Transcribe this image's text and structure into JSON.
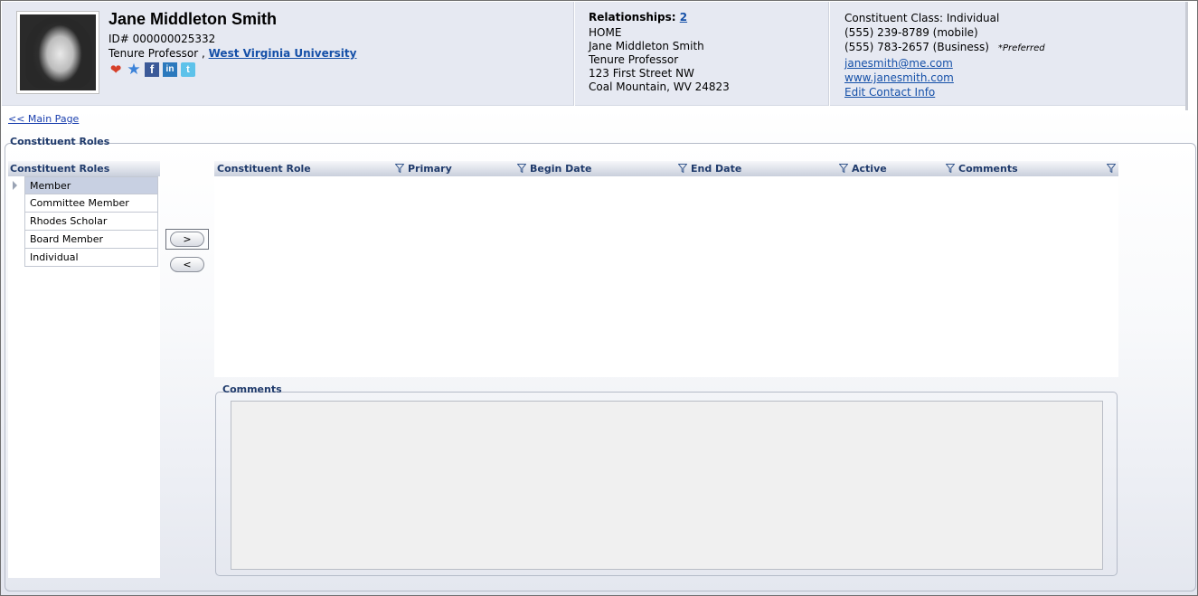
{
  "profile": {
    "name": "Jane Middleton Smith",
    "id_line": "ID# 000000025332",
    "title": "Tenure Professor , ",
    "institution": "West Virginia University",
    "social_icons": [
      "heart-icon",
      "star-icon",
      "facebook-icon",
      "linkedin-icon",
      "twitter-icon"
    ]
  },
  "relationships": {
    "label": "Relationships: ",
    "count": "2",
    "address_lines": [
      "HOME",
      "Jane Middleton Smith",
      "Tenure Professor",
      "123 First Street NW",
      "Coal Mountain, WV 24823"
    ]
  },
  "contact": {
    "class_line": "Constituent Class: Individual",
    "phone_mobile": "(555) 239-8789 (mobile)",
    "phone_business": "(555) 783-2657 (Business)",
    "preferred": "*Preferred",
    "email": "janesmith@me.com",
    "website": "www.janesmith.com",
    "edit_link": "Edit Contact Info"
  },
  "nav": {
    "main_page": "<< Main Page"
  },
  "section": {
    "title": "Constituent Roles"
  },
  "roles_list": {
    "header": "Constituent Roles",
    "items": [
      "Member",
      "Committee Member",
      "Rhodes Scholar",
      "Board Member",
      "Individual"
    ],
    "selected_index": 0
  },
  "buttons": {
    "add": ">",
    "remove": "<"
  },
  "grid": {
    "columns": [
      "Constituent Role",
      "Primary",
      "Begin Date",
      "End Date",
      "Active",
      "Comments"
    ],
    "rows": []
  },
  "comments": {
    "label": "Comments",
    "value": ""
  },
  "colors": {
    "header_bg": "#e6e9f2",
    "link": "#1550a8",
    "section_title": "#1f3a6b",
    "selected_row": "#c8d0e2"
  }
}
